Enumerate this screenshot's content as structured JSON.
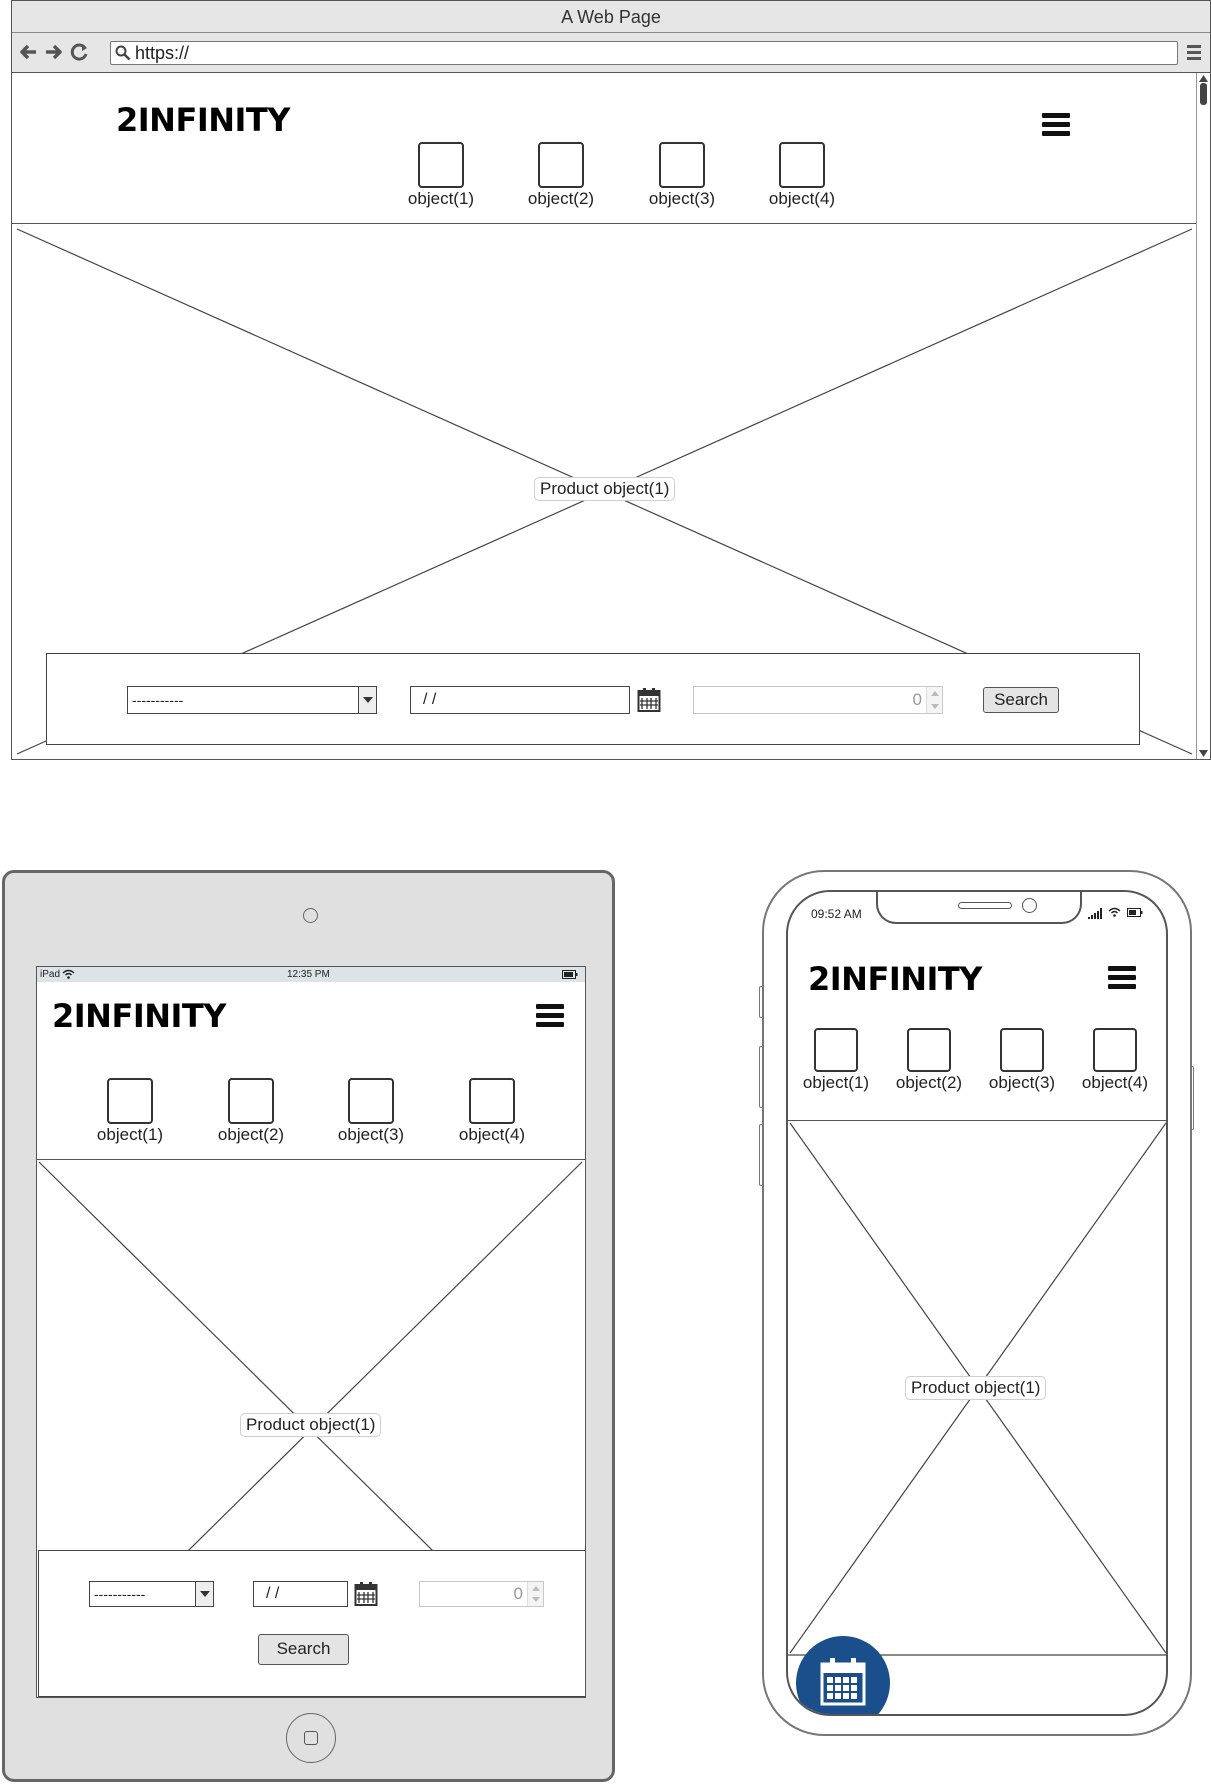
{
  "browser": {
    "title": "A Web Page",
    "url": "https://"
  },
  "site": {
    "logo": "2INFINITY",
    "nav_objects": [
      "object(1)",
      "object(2)",
      "object(3)",
      "object(4)"
    ],
    "hero_label": "Product object(1)",
    "search": {
      "select_value": "-----------",
      "date_value": " /  /",
      "number_value": "0",
      "button_label": "Search"
    }
  },
  "ipad": {
    "status_left": "iPad",
    "status_time": "12:35 PM"
  },
  "iphone": {
    "status_time": "09:52 AM"
  },
  "colors": {
    "fab": "#1a4f8c",
    "device_frame": "#e0e0e0"
  },
  "icons": [
    "back-arrow-icon",
    "forward-arrow-icon",
    "reload-icon",
    "search-icon",
    "browser-menu-icon",
    "hamburger-icon",
    "calendar-icon",
    "wifi-icon",
    "battery-icon",
    "signal-icon",
    "home-button-icon"
  ]
}
